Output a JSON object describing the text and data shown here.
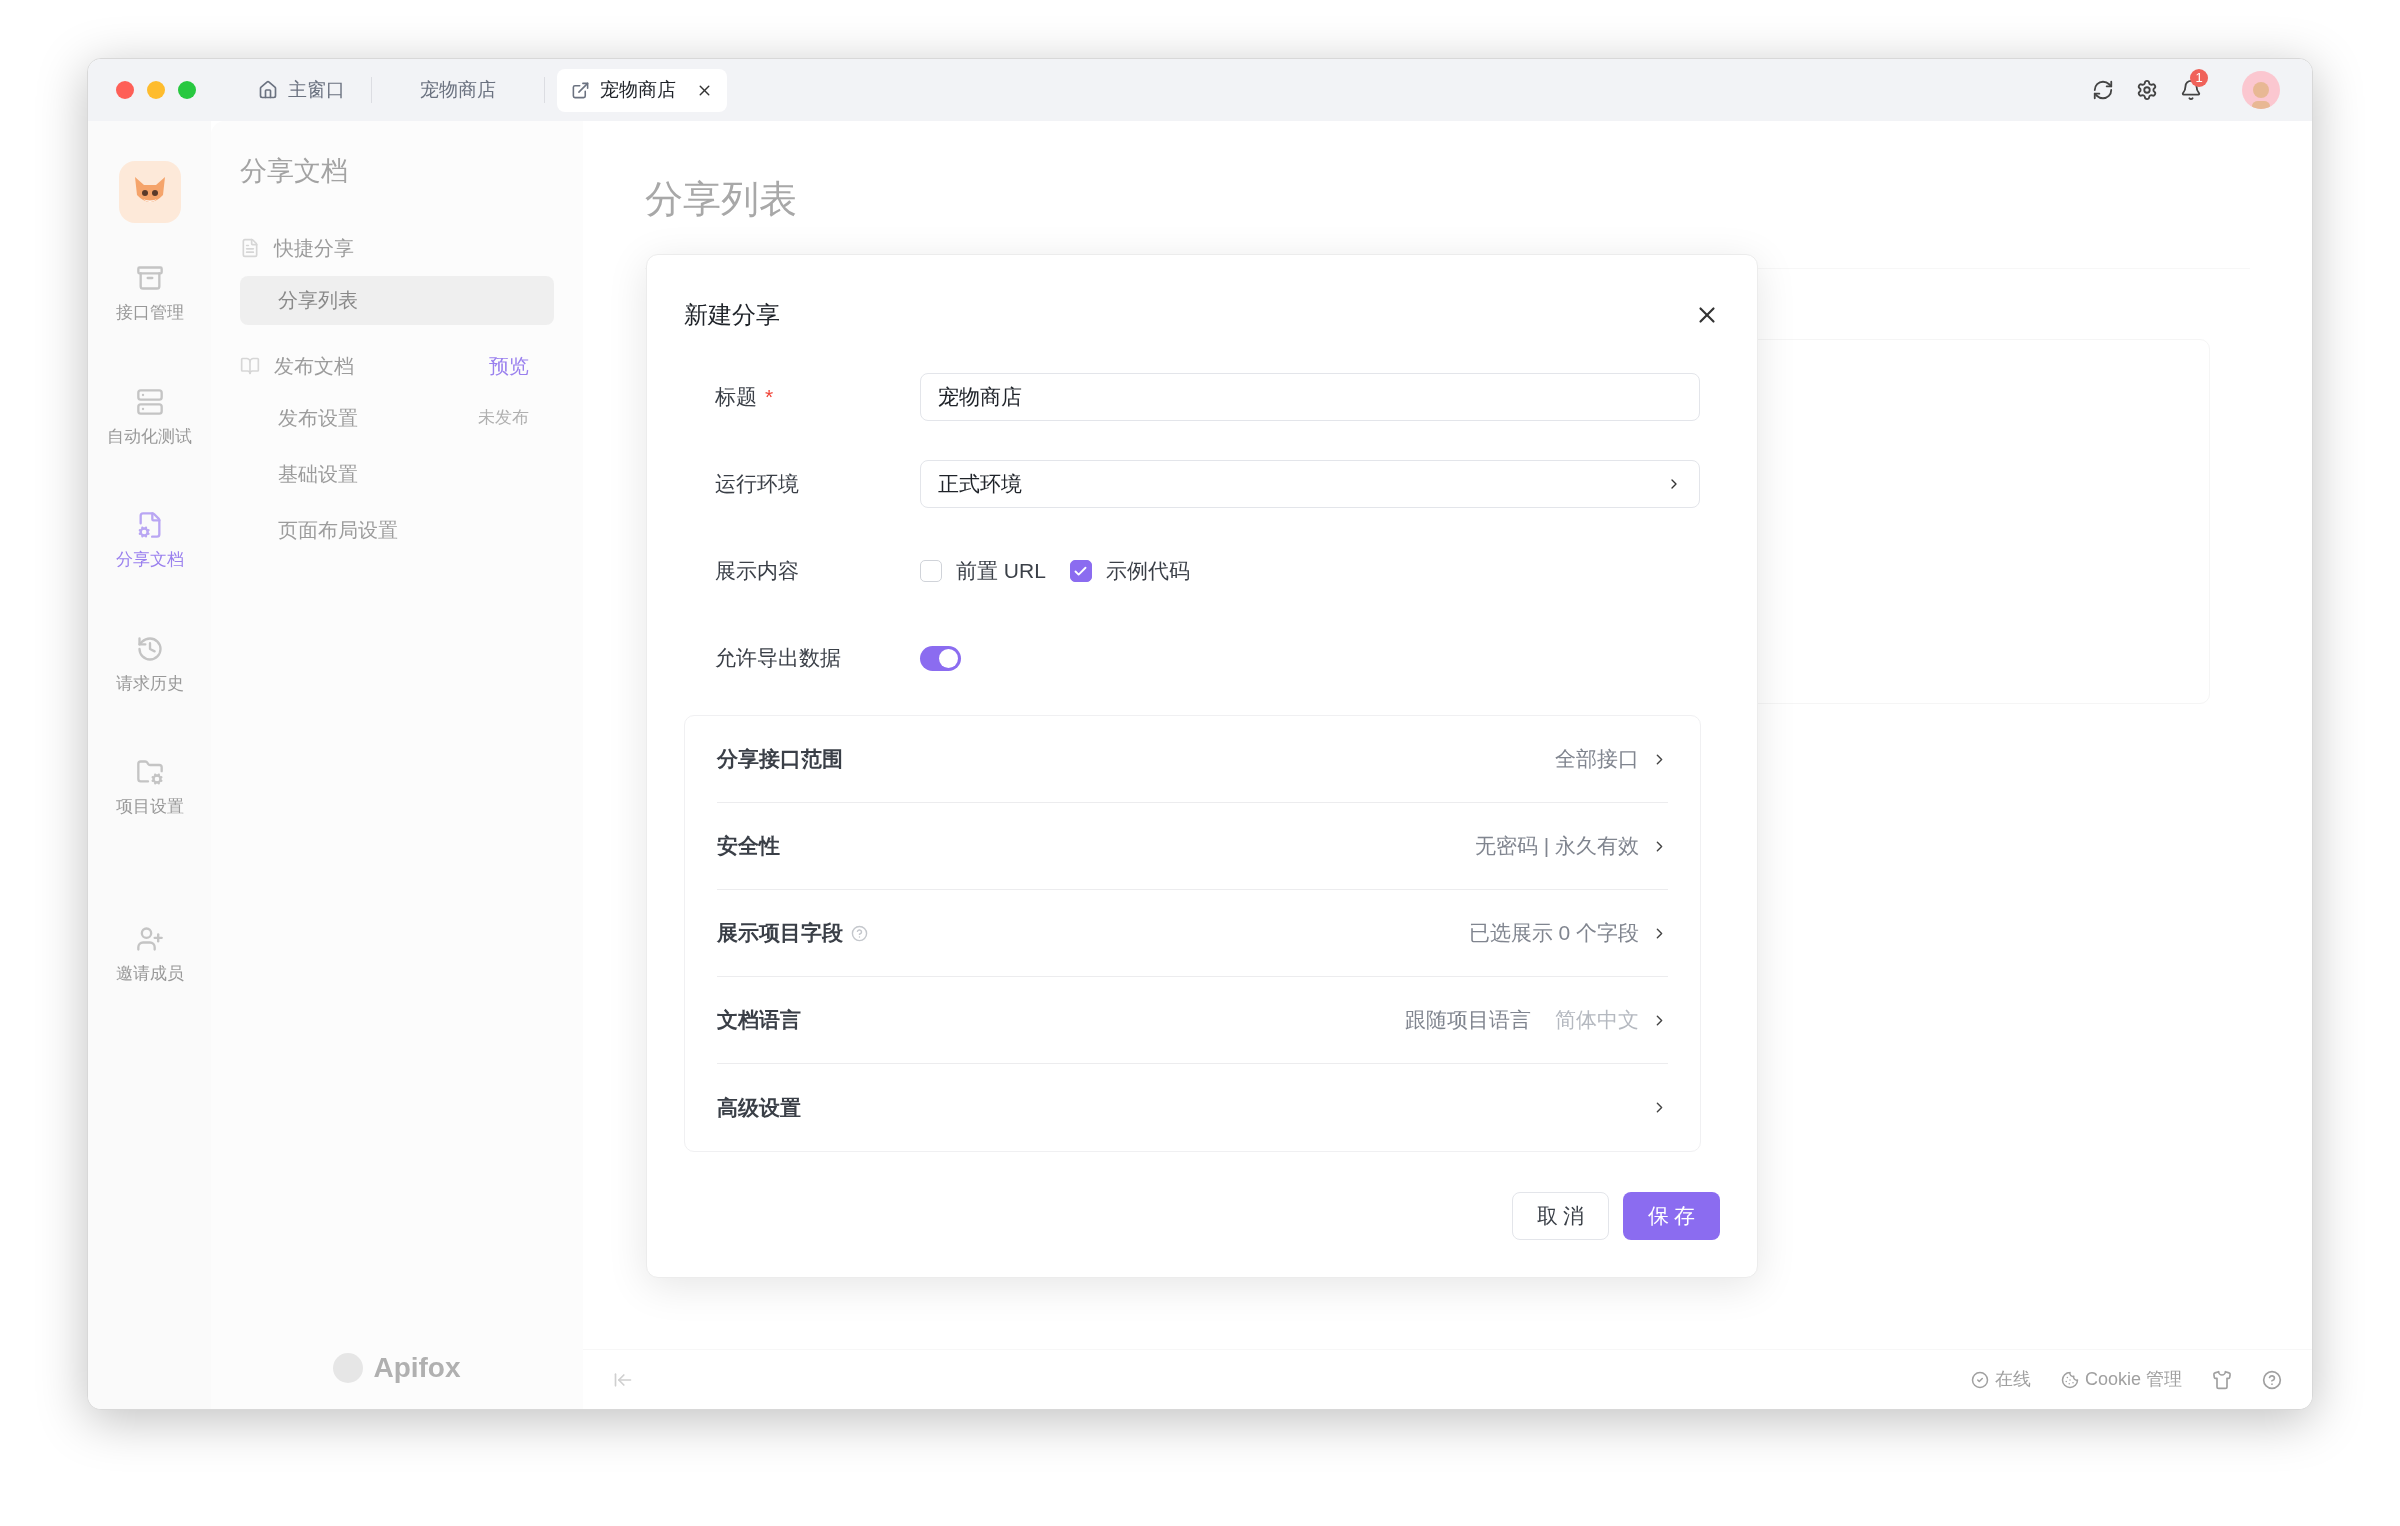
{
  "window": {
    "tabs": [
      {
        "label": "主窗口",
        "selected": false,
        "kind": "home"
      },
      {
        "label": "宠物商店",
        "selected": false,
        "kind": "plain"
      },
      {
        "label": "宠物商店",
        "selected": true,
        "kind": "doc"
      }
    ],
    "notification_count": "1"
  },
  "rail": {
    "items": [
      {
        "label": "接口管理",
        "selected": false
      },
      {
        "label": "自动化测试",
        "selected": false
      },
      {
        "label": "分享文档",
        "selected": true
      },
      {
        "label": "请求历史",
        "selected": false
      },
      {
        "label": "项目设置",
        "selected": false
      },
      {
        "label": "邀请成员",
        "selected": false
      }
    ]
  },
  "sidebar": {
    "title": "分享文档",
    "items": [
      {
        "label": "快捷分享",
        "kind": "share",
        "children": [
          {
            "label": "分享列表",
            "selected": true
          }
        ]
      },
      {
        "label": "发布文档",
        "kind": "book",
        "badge": "预览",
        "children": [
          {
            "label": "发布设置",
            "selected": false,
            "badge": "未发布"
          },
          {
            "label": "基础设置",
            "selected": false
          },
          {
            "label": "页面布局设置",
            "selected": false
          }
        ]
      }
    ],
    "logo_text": "Apifox"
  },
  "main": {
    "heading": "分享列表"
  },
  "dialog": {
    "title": "新建分享",
    "fields": [
      {
        "kind": "text",
        "label": "标题",
        "mark": "*",
        "value": "宠物商店"
      },
      {
        "kind": "select",
        "label": "运行环境",
        "value": "正式环境"
      },
      {
        "kind": "checkboxes",
        "label": "展示内容",
        "options": [
          {
            "label": "前置 URL",
            "checked": false
          },
          {
            "label": "示例代码",
            "checked": true
          }
        ]
      },
      {
        "kind": "switch",
        "label": "允许导出数据",
        "on": true
      }
    ],
    "settings": [
      {
        "label": "分享接口范围",
        "value": "全部接口"
      },
      {
        "label": "安全性",
        "value": "无密码 | 永久有效"
      },
      {
        "label": "展示项目字段",
        "help": true,
        "value": "已选展示 0 个字段"
      },
      {
        "label": "文档语言",
        "value": "跟随项目语言",
        "value_2": "简体中文"
      },
      {
        "label": "高级设置"
      }
    ],
    "buttons": [
      {
        "label": "取 消",
        "kind": "secondary"
      },
      {
        "label": "保 存",
        "kind": "primary"
      }
    ]
  },
  "status_bar": {
    "items": [
      {
        "label": "在线",
        "kind": "online"
      },
      {
        "label": "Cookie 管理",
        "kind": "cookie"
      }
    ]
  }
}
